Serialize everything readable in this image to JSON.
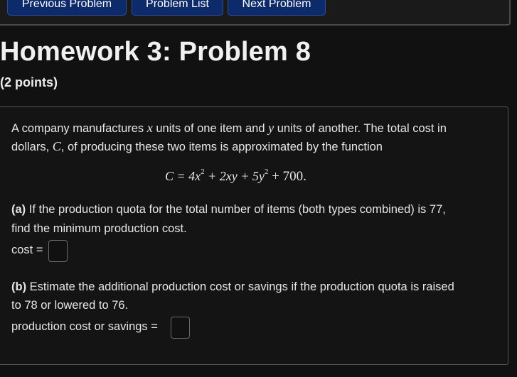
{
  "nav": {
    "prev_label": "Previous Problem",
    "list_label": "Problem List",
    "next_label": "Next Problem"
  },
  "header": {
    "title": "Homework 3: Problem 8",
    "points": "(2 points)"
  },
  "problem": {
    "intro_line1_a": "A company manufactures ",
    "var_x": "x",
    "intro_line1_b": " units of one item and ",
    "var_y": "y",
    "intro_line1_c": " units of another. The total cost in",
    "intro_line2_a": "dollars, ",
    "var_c": "C",
    "intro_line2_b": ", of producing these two items is approximated by the function",
    "formula": {
      "lhs": "C = 4x",
      "exp1": "2",
      "mid": " + 2xy + 5y",
      "exp2": "2",
      "rhs": " + 700."
    },
    "part_a_tag": "(a)",
    "part_a_line1": " If the production quota for the total number of items (both types combined) is 77,",
    "part_a_line2": "find the minimum production cost.",
    "cost_label": "cost =",
    "part_b_tag": "(b)",
    "part_b_line1": " Estimate the additional production cost or savings if the production quota is raised",
    "part_b_line2": "to 78 or lowered to 76.",
    "savings_label": "production cost or savings ="
  },
  "colors": {
    "background": "#111111",
    "nav_button": "#0d2a6b"
  }
}
